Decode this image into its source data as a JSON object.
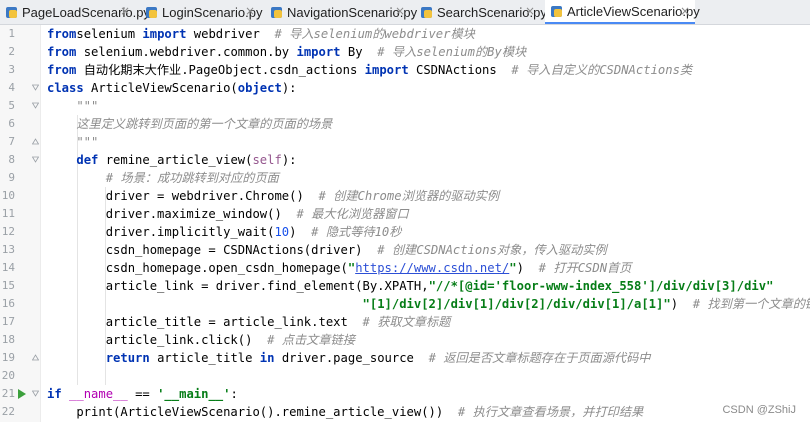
{
  "tabs": [
    {
      "label": "PageLoadScenario.py",
      "active": false
    },
    {
      "label": "LoginScenario.py",
      "active": false
    },
    {
      "label": "NavigationScenario.py",
      "active": false
    },
    {
      "label": "SearchScenario.py",
      "active": false
    },
    {
      "label": "ArticleViewScenario.py",
      "active": true
    }
  ],
  "close_glyph": "×",
  "code_lines": [
    {
      "n": "1",
      "tokens": [
        [
          "kw",
          "from"
        ],
        [
          "",
          "selenium "
        ],
        [
          "kw",
          "import"
        ],
        [
          "",
          " webdriver  "
        ],
        [
          "cmt",
          "# 导入selenium的webdriver模块"
        ]
      ]
    },
    {
      "n": "2",
      "tokens": [
        [
          "kw",
          "from"
        ],
        [
          "",
          " selenium.webdriver.common.by "
        ],
        [
          "kw",
          "import"
        ],
        [
          "",
          " By  "
        ],
        [
          "cmt",
          "# 导入selenium的By模块"
        ]
      ]
    },
    {
      "n": "3",
      "tokens": [
        [
          "kw",
          "from"
        ],
        [
          "",
          " 自动化期末大作业.PageObject.csdn_actions "
        ],
        [
          "kw",
          "import"
        ],
        [
          "",
          " CSDNActions  "
        ],
        [
          "cmt",
          "# 导入自定义的CSDNActions类"
        ]
      ]
    },
    {
      "n": "4",
      "tokens": [
        [
          "kw",
          "class"
        ],
        [
          "",
          " ArticleViewScenario("
        ],
        [
          "kw",
          "object"
        ],
        [
          "",
          "):"
        ]
      ]
    },
    {
      "n": "5",
      "tokens": [
        [
          "cmt",
          "    \"\"\""
        ]
      ]
    },
    {
      "n": "6",
      "tokens": [
        [
          "cmt",
          "    这里定义跳转到页面的第一个文章的页面的场景"
        ]
      ]
    },
    {
      "n": "7",
      "tokens": [
        [
          "cmt",
          "    \"\"\""
        ]
      ]
    },
    {
      "n": "8",
      "tokens": [
        [
          "",
          "    "
        ],
        [
          "kw",
          "def"
        ],
        [
          "",
          " remine_article_view("
        ],
        [
          "self",
          "self"
        ],
        [
          "",
          "):"
        ]
      ]
    },
    {
      "n": "9",
      "tokens": [
        [
          "",
          "        "
        ],
        [
          "cmt",
          "# 场景：成功跳转到对应的页面"
        ]
      ]
    },
    {
      "n": "10",
      "tokens": [
        [
          "",
          "        driver = webdriver.Chrome()  "
        ],
        [
          "cmt",
          "# 创建Chrome浏览器的驱动实例"
        ]
      ]
    },
    {
      "n": "11",
      "tokens": [
        [
          "",
          "        driver.maximize_window()  "
        ],
        [
          "cmt",
          "# 最大化浏览器窗口"
        ]
      ]
    },
    {
      "n": "12",
      "tokens": [
        [
          "",
          "        driver.implicitly_wait("
        ],
        [
          "num",
          "10"
        ],
        [
          "",
          ")  "
        ],
        [
          "cmt",
          "# 隐式等待10秒"
        ]
      ]
    },
    {
      "n": "13",
      "tokens": [
        [
          "",
          "        csdn_homepage = CSDNActions(driver)  "
        ],
        [
          "cmt",
          "# 创建CSDNActions对象，传入驱动实例"
        ]
      ]
    },
    {
      "n": "14",
      "tokens": [
        [
          "",
          "        csdn_homepage.open_csdn_homepage("
        ],
        [
          "str",
          "\""
        ],
        [
          "url",
          "https://www.csdn.net/"
        ],
        [
          "str",
          "\""
        ],
        [
          "",
          ")  "
        ],
        [
          "cmt",
          "# 打开CSDN首页"
        ]
      ]
    },
    {
      "n": "15",
      "tokens": [
        [
          "",
          "        article_link = driver.find_element(By.XPATH,"
        ],
        [
          "str",
          "\"//*[@id='floor-www-index_558']/div/div[3]/div\""
        ]
      ]
    },
    {
      "n": "16",
      "tokens": [
        [
          "",
          "                                           "
        ],
        [
          "str",
          "\"[1]/div[2]/div[1]/div[2]/div/div[1]/a[1]\""
        ],
        [
          "",
          ")  "
        ],
        [
          "cmt",
          "# 找到第一个文章的链接"
        ]
      ]
    },
    {
      "n": "17",
      "tokens": [
        [
          "",
          "        article_title = article_link.text  "
        ],
        [
          "cmt",
          "# 获取文章标题"
        ]
      ]
    },
    {
      "n": "18",
      "tokens": [
        [
          "",
          "        article_link.click()  "
        ],
        [
          "cmt",
          "# 点击文章链接"
        ]
      ]
    },
    {
      "n": "19",
      "tokens": [
        [
          "",
          "        "
        ],
        [
          "kw",
          "return"
        ],
        [
          "",
          " article_title "
        ],
        [
          "kw",
          "in"
        ],
        [
          "",
          " driver.page_source  "
        ],
        [
          "cmt",
          "# 返回是否文章标题存在于页面源代码中"
        ]
      ]
    },
    {
      "n": "20",
      "tokens": []
    },
    {
      "n": "21",
      "tokens": [
        [
          "kw",
          "if"
        ],
        [
          "",
          " "
        ],
        [
          "dunder",
          "__name__"
        ],
        [
          "",
          " == "
        ],
        [
          "str",
          "'__main__'"
        ],
        [
          "",
          ":"
        ]
      ]
    },
    {
      "n": "22",
      "tokens": [
        [
          "",
          "    print(ArticleViewScenario().remine_article_view())  "
        ],
        [
          "cmt",
          "# 执行文章查看场景，并打印结果"
        ]
      ]
    }
  ],
  "run_marker_line": "21",
  "watermark": "CSDN @ZShiJ",
  "colors": {
    "keyword": "#0033b3",
    "comment": "#8c8c8c",
    "string": "#067d17",
    "number": "#1750eb",
    "self": "#94558d",
    "active_tab_underline": "#4a8af4",
    "run_arrow": "#3ca03c"
  },
  "icons": [
    "python-file-icon",
    "close-icon",
    "run-icon",
    "fold-icon"
  ]
}
